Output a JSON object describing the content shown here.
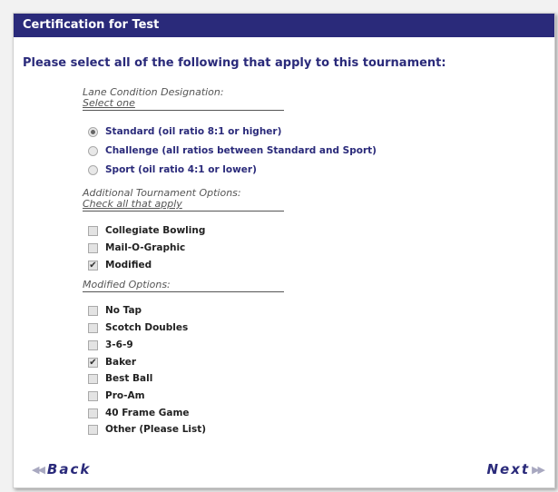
{
  "window": {
    "title": "Certification for Test"
  },
  "prompt": "Please select all of the following that apply to this tournament:",
  "lane": {
    "heading": "Lane Condition Designation:",
    "subheading": "Select one",
    "options": [
      {
        "label": "Standard (oil ratio 8:1 or higher)",
        "checked": true
      },
      {
        "label": "Challenge (all ratios between Standard and Sport)",
        "checked": false
      },
      {
        "label": "Sport (oil ratio 4:1 or lower)",
        "checked": false
      }
    ]
  },
  "additional": {
    "heading": "Additional Tournament Options:",
    "subheading": "Check all that apply",
    "options": [
      {
        "label": "Collegiate Bowling",
        "checked": false
      },
      {
        "label": "Mail-O-Graphic",
        "checked": false
      },
      {
        "label": "Modified",
        "checked": true
      }
    ]
  },
  "modified": {
    "heading": "Modified Options:",
    "options": [
      {
        "label": "No Tap",
        "checked": false
      },
      {
        "label": "Scotch Doubles",
        "checked": false
      },
      {
        "label": "3-6-9",
        "checked": false
      },
      {
        "label": "Baker",
        "checked": true
      },
      {
        "label": "Best Ball",
        "checked": false
      },
      {
        "label": "Pro-Am",
        "checked": false
      },
      {
        "label": "40 Frame Game",
        "checked": false
      },
      {
        "label": "Other (Please List)",
        "checked": false
      }
    ]
  },
  "nav": {
    "back_label": "Back",
    "next_label": "Next"
  },
  "colors": {
    "title_bar": "#2a2a7a",
    "accent_text": "#2a2a7a"
  }
}
